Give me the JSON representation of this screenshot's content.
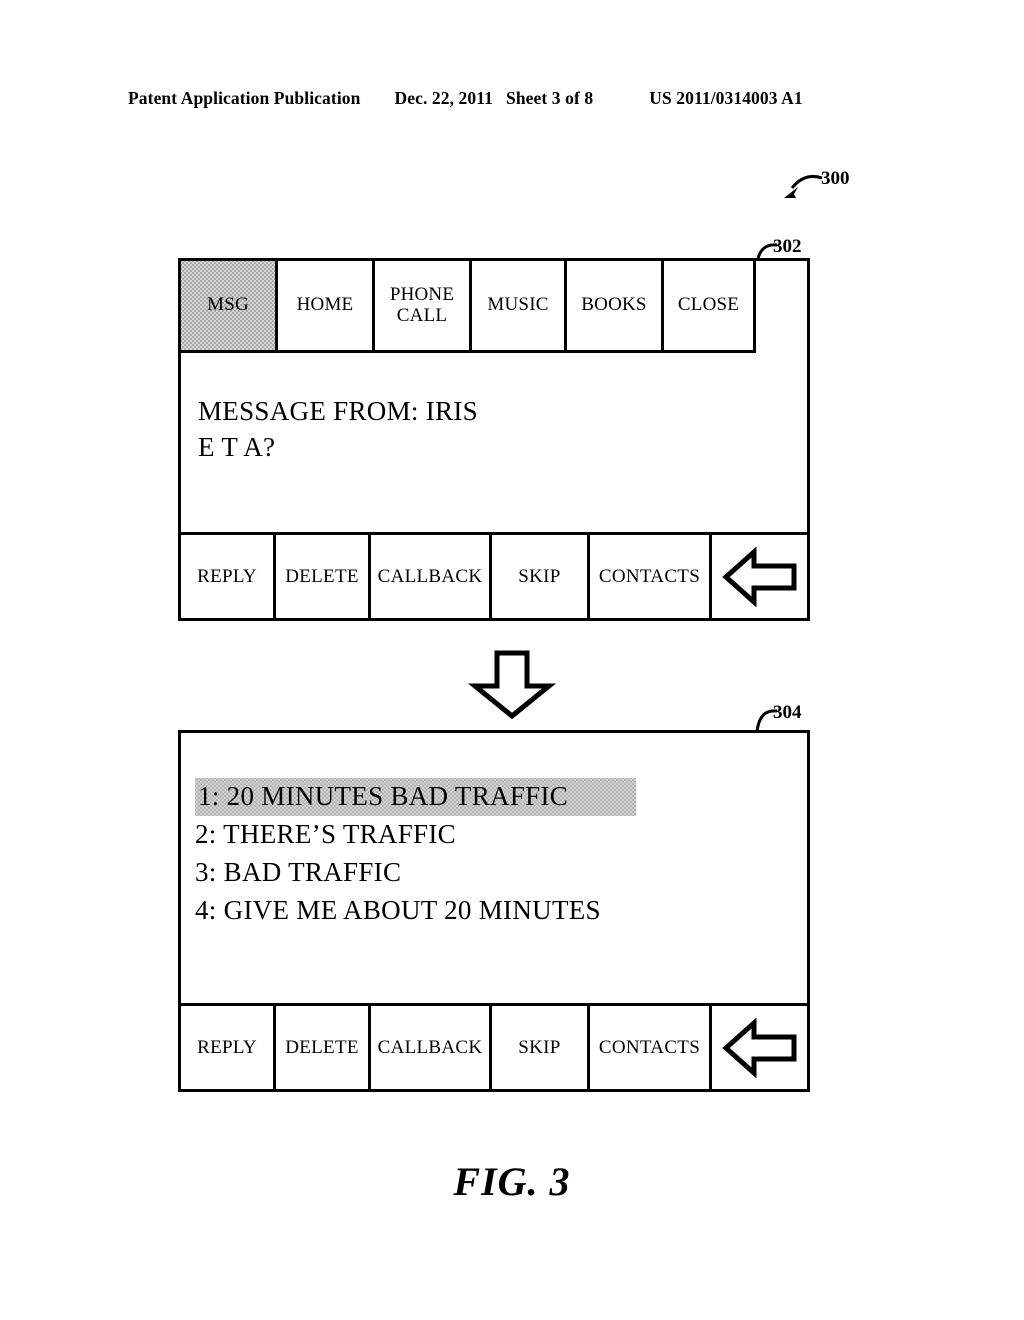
{
  "page_header": {
    "publication": "Patent Application Publication",
    "date": "Dec. 22, 2011",
    "sheet": "Sheet 3 of 8",
    "patent_number": "US 2011/0314003 A1"
  },
  "figure": {
    "caption": "FIG. 3",
    "reference_numerals": {
      "overall": "300",
      "first_screen": "302",
      "second_screen": "304"
    }
  },
  "screen_302": {
    "menu_bar": [
      {
        "label": "MSG",
        "selected": true
      },
      {
        "label": "HOME",
        "selected": false
      },
      {
        "label": "PHONE CALL",
        "label_line1": "PHONE",
        "label_line2": "CALL",
        "selected": false
      },
      {
        "label": "MUSIC",
        "selected": false
      },
      {
        "label": "BOOKS",
        "selected": false
      },
      {
        "label": "CLOSE",
        "selected": false
      }
    ],
    "message": {
      "line1": "MESSAGE FROM: IRIS",
      "line2": "E T A?"
    },
    "action_bar": [
      {
        "label": "REPLY"
      },
      {
        "label": "DELETE"
      },
      {
        "label": "CALLBACK"
      },
      {
        "label": "SKIP"
      },
      {
        "label": "CONTACTS"
      },
      {
        "label": "",
        "icon": "back-arrow-icon"
      }
    ]
  },
  "screen_304": {
    "reply_options": [
      {
        "label": "1: 20 MINUTES BAD TRAFFIC",
        "selected": true
      },
      {
        "label": "2: THERE’S TRAFFIC",
        "selected": false
      },
      {
        "label": "3: BAD TRAFFIC",
        "selected": false
      },
      {
        "label": "4: GIVE ME ABOUT 20 MINUTES",
        "selected": false
      }
    ],
    "action_bar": [
      {
        "label": "REPLY"
      },
      {
        "label": "DELETE"
      },
      {
        "label": "CALLBACK"
      },
      {
        "label": "SKIP"
      },
      {
        "label": "CONTACTS"
      },
      {
        "label": "",
        "icon": "back-arrow-icon"
      }
    ]
  },
  "transition": {
    "icon": "down-arrow-icon"
  },
  "colors": {
    "line": "#000000",
    "background": "#ffffff",
    "highlight_fill": "#d4d4d4"
  }
}
